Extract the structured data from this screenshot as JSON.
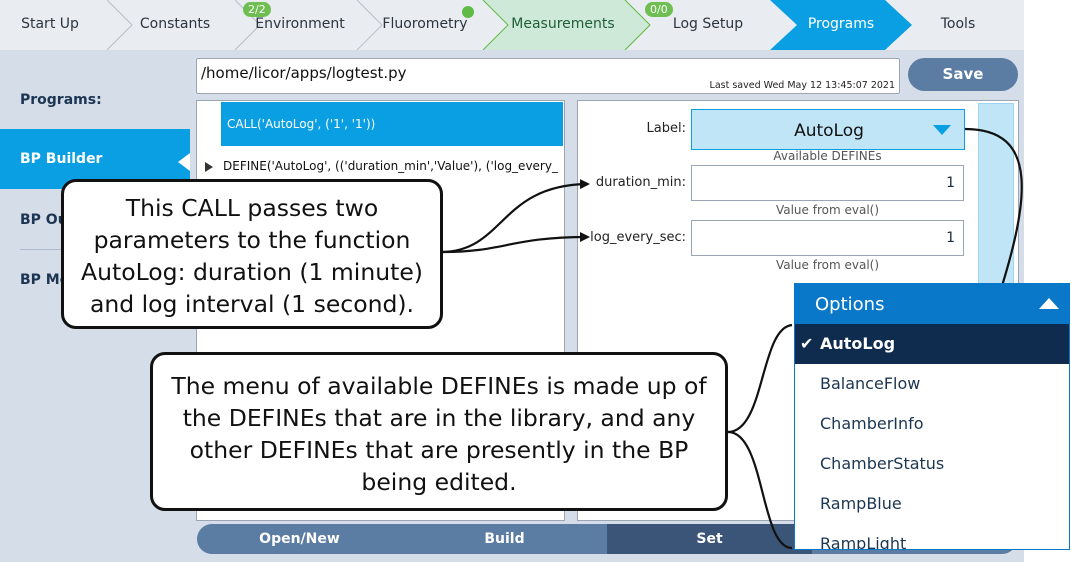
{
  "topnav": {
    "tabs": [
      {
        "label": "Start Up",
        "state": "normal"
      },
      {
        "label": "Constants",
        "state": "normal"
      },
      {
        "label": "Environment",
        "state": "normal",
        "badge": "2/2"
      },
      {
        "label": "Fluorometry",
        "state": "normal",
        "status_dot": "green"
      },
      {
        "label": "Measurements",
        "state": "highlight"
      },
      {
        "label": "Log Setup",
        "state": "normal",
        "badge": "0/0"
      },
      {
        "label": "Programs",
        "state": "active"
      },
      {
        "label": "Tools",
        "state": "normal"
      }
    ]
  },
  "sidebar": {
    "items": [
      {
        "label": "Programs:"
      },
      {
        "label": "BP Builder",
        "active": true
      },
      {
        "label": "BP Ou"
      },
      {
        "label": "BP Mo"
      }
    ]
  },
  "editor": {
    "file_path": "/home/licor/apps/logtest.py",
    "last_saved": "Last saved Wed May 12 13:45:07 2021",
    "save_label": "Save",
    "call_line": "CALL('AutoLog', ('1', '1'))",
    "define_line": "DEFINE('AutoLog', (('duration_min','Value'), ('log_every_"
  },
  "form": {
    "label_field": "Label:",
    "label_value": "AutoLog",
    "label_hint": "Available DEFINEs",
    "params": [
      {
        "name": "duration_min:",
        "value": "1",
        "hint": "Value from eval()"
      },
      {
        "name": "log_every_sec:",
        "value": "1",
        "hint": "Value from eval()"
      }
    ]
  },
  "bottom_bar": {
    "buttons": [
      {
        "label": "Open/New"
      },
      {
        "label": "Build"
      },
      {
        "label": "Set",
        "active": true
      }
    ]
  },
  "options_menu": {
    "title": "Options",
    "items": [
      {
        "label": "AutoLog",
        "selected": true
      },
      {
        "label": "BalanceFlow"
      },
      {
        "label": "ChamberInfo"
      },
      {
        "label": "ChamberStatus"
      },
      {
        "label": "RampBlue"
      },
      {
        "label": "RampLight"
      }
    ]
  },
  "callouts": {
    "call_explanation": [
      "This CALL passes two",
      "parameters to the function",
      "AutoLog: duration (1 minute)",
      "and log interval (1 second)."
    ],
    "menu_explanation": [
      "The menu of available DEFINEs is made up of",
      "the DEFINEs that are in the library, and any",
      "other DEFINEs that are presently in the BP",
      "being edited."
    ]
  },
  "colors": {
    "active_blue": "#0a9fe3",
    "measurements_green": "#cfe9d8",
    "nav_bg": "#e9ecf0",
    "panel_bg": "#d5dde8",
    "button_blue": "#5b7ca3",
    "dropdown_header": "#0a78c8",
    "selected_option": "#0f2c4e"
  }
}
